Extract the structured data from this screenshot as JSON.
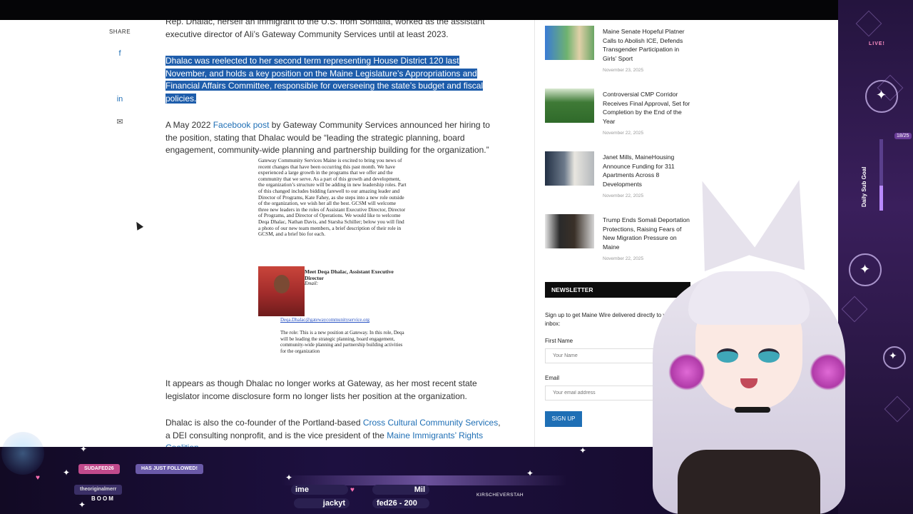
{
  "share": {
    "label": "SHARE",
    "icons": [
      {
        "name": "facebook-icon",
        "glyph": "f"
      },
      {
        "name": "x-icon",
        "glyph": ""
      },
      {
        "name": "linkedin-icon",
        "glyph": "in"
      },
      {
        "name": "email-icon",
        "glyph": "✉"
      }
    ]
  },
  "article": {
    "intro": "Rep. Dhalac, herself an immigrant to the U.S. from Somalia, worked as the assistant executive director of Ali’s Gateway Community Services until at least 2023.",
    "highlighted": "Dhalac was reelected to her second term representing House District 120 last November, and holds a key position on the Maine Legislature’s Appropriations and Financial Affairs Committee, responsible for overseeing the state’s budget and fiscal policies.",
    "p2_before": "A May 2022 ",
    "p2_link": "Facebook post",
    "p2_after": " by Gateway Community Services announced her hiring to the position, stating that Dhalac would be “leading the strategic planning, board engagement, community-wide planning and partnership building for the organization.”",
    "p3": "It appears as though Dhalac no longer works at Gateway, as her most recent state legislator income disclosure form no longer lists her position at the organization.",
    "p4_before": "Dhalac is also the co-founder of the Portland-based ",
    "p4_link1": "Cross Cultural Community Services",
    "p4_mid": ", a DEI consulting nonprofit, and is the vice president of the ",
    "p4_link2": "Maine Immigrants’ Rights Coalition",
    "p4_after": "."
  },
  "scan": {
    "body": "Gateway Community Services Maine is excited to bring you news of recent changes that have been occurring this past month. We have experienced a large growth in the programs that we offer and the community that we serve. As a part of this growth and development, the organization’s structure will be adding in new leadership roles. Part of this changed includes bidding farewell to our amazing leader and Director of Programs, Kate Fahey, as she steps into a new role outside of the organization, we wish her all the best. GCSM will welcome three new leaders in the roles of Assistant Executive Director, Director of Programs, and Director of Operations. We would like to welcome Deqa Dhalac, Nathan Davis, and Starsha Schiller; below you will find a photo of our new team members, a brief description of their role in GCSM, and a brief bio for each.",
    "name": "Meet Deqa Dhalac, Assistant Executive Director",
    "email_label": "Email:",
    "email_link": "Deqa.Dhalac@gatewaycommunityservice.org",
    "role": "The role: This is a new position at Gateway. In this role, Deqa will be leading the strategic planning, board engagement, community-wide planning and partnership building activities for the organization"
  },
  "sidebar": {
    "items": [
      {
        "title": "Maine Senate Hopeful Platner Calls to Abolish ICE, Defends Transgender Participation in Girls’ Sport",
        "date": "November 23, 2025"
      },
      {
        "title": "Controversial CMP Corridor Receives Final Approval, Set for Completion by the End of the Year",
        "date": "November 22, 2025"
      },
      {
        "title": "Janet Mills, MaineHousing Announce Funding for 311 Apartments Across 8 Developments",
        "date": "November 22, 2025"
      },
      {
        "title": "Trump Ends Somali Deportation Protections, Raising Fears of New Migration Pressure on Maine",
        "date": "November 22, 2025"
      }
    ],
    "newsletter": {
      "heading": "NEWSLETTER",
      "description": "Sign up to get Maine Wire delivered directly to your inbox:",
      "first_name_label": "First Name",
      "first_name_placeholder": "Your Name",
      "email_label": "Email",
      "email_placeholder": "Your email address",
      "button": "SIGN UP"
    }
  },
  "stream": {
    "live": "LIVE!",
    "goal_label": "Daily Sub Goal",
    "goal_count": "18/25",
    "follower_name": "SUDAFED26",
    "follow_text": "HAS JUST FOLLOWED!",
    "follower_name2": "theoriginalmerr",
    "boom": "BOOM",
    "ticker1": "ime",
    "ticker2": "Mil",
    "ticker3": "jackyt",
    "ticker4": "fed26 - 200",
    "credit": "KIRSCHEVERSTAH"
  }
}
